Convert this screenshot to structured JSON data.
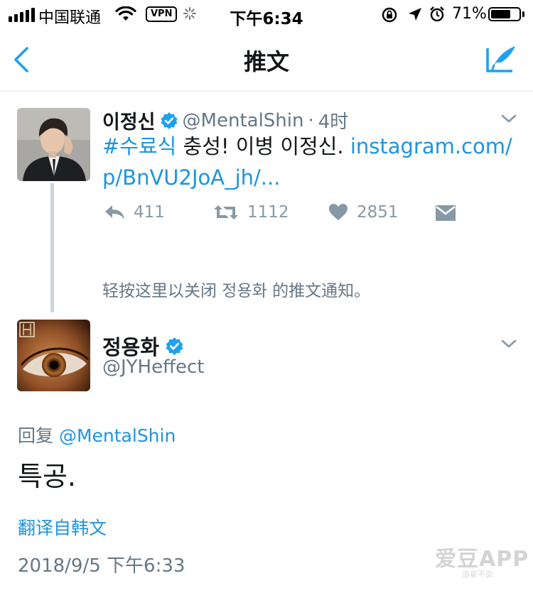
{
  "status_bar": {
    "carrier": "中国联通",
    "vpn": "VPN",
    "time": "下午6:34",
    "battery": "71%",
    "battery_level": 0.71
  },
  "nav": {
    "title": "推文",
    "back_icon": "chevron-left-icon",
    "compose_icon": "compose-tweet-icon"
  },
  "quoted_tweet": {
    "name": "이정신",
    "handle": "@MentalShin",
    "separator": "·",
    "time": "4时",
    "hashtag": "#수료식",
    "text": " 충성! 이병 이정신. ",
    "link": "instagram.com/p/BnVU2JoA_jh/...",
    "reply_count": "411",
    "retweet_count": "1112",
    "like_count": "2851"
  },
  "notice": "轻按这里以关闭 정용화 的推文通知。",
  "main_tweet": {
    "name": "정용화",
    "handle": "@JYHeffect",
    "reply_prefix": "回复 ",
    "reply_to": "@MentalShin",
    "text": "특공.",
    "translate": "翻译自韩文",
    "timestamp": "2018/9/5 下午6:33"
  },
  "watermark": {
    "main": "爱豆APP",
    "sub": "追星不会"
  },
  "colors": {
    "link": "#1b95e0",
    "secondary": "#657786",
    "icon_gray": "#8899a6",
    "verified": "#1da1f2"
  }
}
